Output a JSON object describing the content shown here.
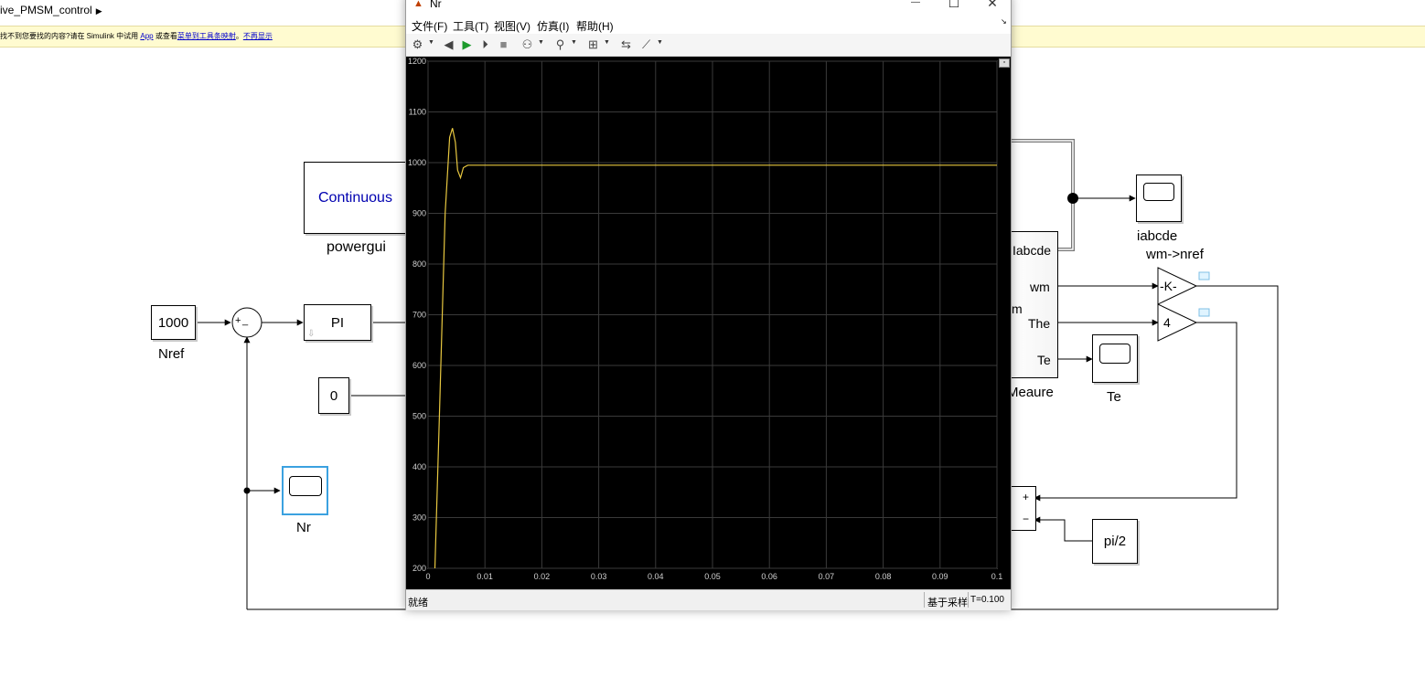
{
  "model": {
    "breadcrumb": "ive_PMSM_control",
    "notice": {
      "text_before": "找不到您要找的内容?请在 Simulink 中试用 ",
      "link_app": "App",
      "text_middle": " 或查看",
      "link_tools": "菜单到工具条映射",
      "text_comma": "。",
      "link_hide": "不再显示"
    }
  },
  "blocks": {
    "powergui": {
      "text": "Continuous",
      "label": "powergui",
      "text_color": "#0000b0"
    },
    "nref": {
      "value": "1000",
      "label": "Nref"
    },
    "sum_signs": {
      "plus": "+",
      "minus": "_"
    },
    "pi": {
      "text": "PI"
    },
    "zero": {
      "value": "0"
    },
    "nr_scope": {
      "label": "Nr"
    },
    "measure": {
      "ports": [
        "Iabcde",
        "wm",
        "The",
        "Te"
      ],
      "partial_text": "m",
      "label": "Meaure"
    },
    "iabcde_scope": {
      "label": "iabcde"
    },
    "gain_wm": {
      "value": "-K-",
      "label": "wm->nref"
    },
    "gain_the": {
      "value": "4"
    },
    "te_scope": {
      "label": "Te"
    },
    "sum2_signs": {
      "plus": "+",
      "minus": "−"
    },
    "pi2": {
      "value": "pi/2"
    }
  },
  "scope_window": {
    "title": "Nr",
    "menus": [
      "文件(F)",
      "工具(T)",
      "视图(V)",
      "仿真(I)",
      "帮助(H)"
    ],
    "toolbar_icons": [
      "settings-icon",
      "step-back-icon",
      "run-icon",
      "step-forward-icon",
      "stop-icon",
      "highlight-icon",
      "zoom-icon",
      "autoscale-icon",
      "trigger-icon",
      "measure-icon"
    ],
    "window_buttons": {
      "minimize": "—",
      "maximize": "☐",
      "close": "✕"
    },
    "status_ready": "就绪",
    "status_mode": "基于采样",
    "status_time": "T=0.100"
  },
  "chart_data": {
    "type": "line",
    "title": "",
    "xlabel": "",
    "ylabel": "",
    "xlim": [
      0,
      0.1
    ],
    "ylim": [
      200,
      1200
    ],
    "xticks": [
      0,
      0.01,
      0.02,
      0.03,
      0.04,
      0.05,
      0.06,
      0.07,
      0.08,
      0.09,
      0.1
    ],
    "yticks": [
      200,
      300,
      400,
      500,
      600,
      700,
      800,
      900,
      1000,
      1100,
      1200
    ],
    "grid": true,
    "background": "#000000",
    "axes_color": "#d0d0d0",
    "series": [
      {
        "color": "#e8c840",
        "x": [
          0.0012,
          0.002,
          0.003,
          0.0038,
          0.0043,
          0.0048,
          0.0052,
          0.0057,
          0.0062,
          0.007,
          0.01,
          0.02,
          0.03,
          0.04,
          0.05,
          0.06,
          0.07,
          0.08,
          0.09,
          0.1
        ],
        "y": [
          200,
          500,
          900,
          1050,
          1068,
          1040,
          985,
          970,
          990,
          995,
          995,
          995,
          995,
          995,
          995,
          995,
          995,
          995,
          995,
          995
        ]
      }
    ]
  }
}
